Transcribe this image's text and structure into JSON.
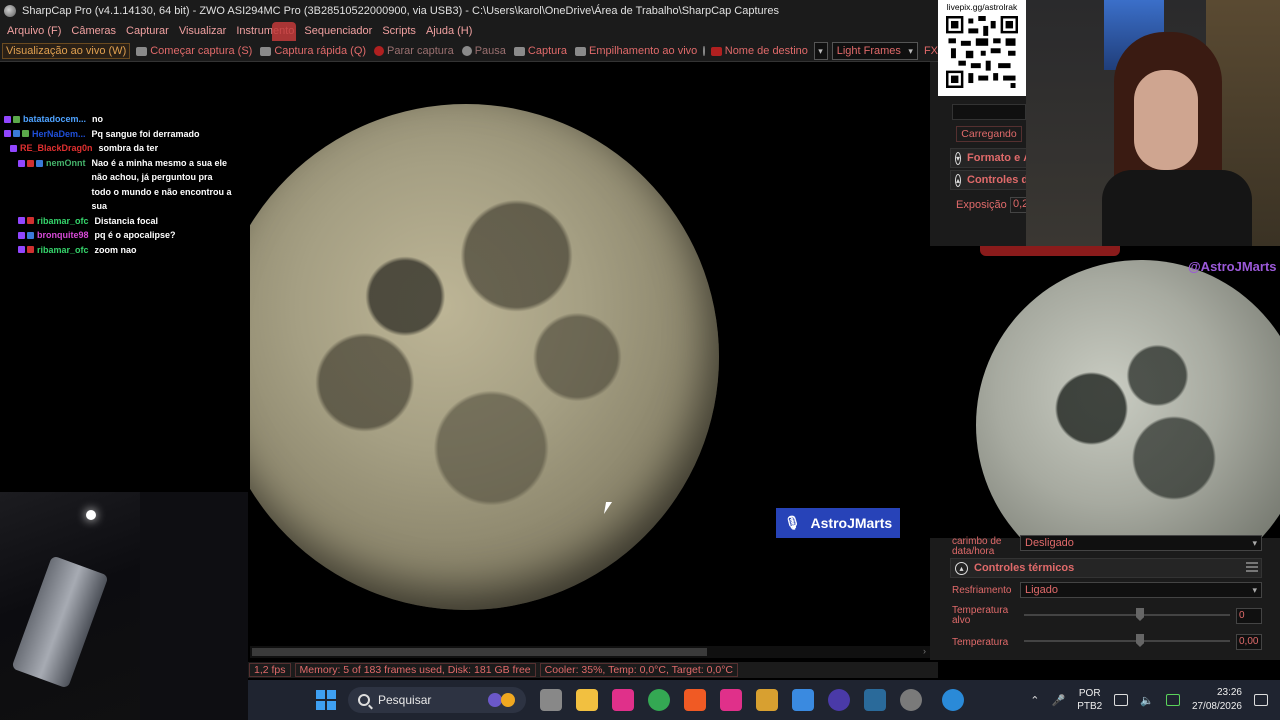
{
  "window": {
    "title": "SharpCap Pro (v4.1.14130, 64 bit) - ZWO ASI294MC Pro (3B28510522000900, via USB3) - C:\\Users\\karol\\OneDrive\\Área de Trabalho\\SharpCap Captures"
  },
  "menu": [
    "Arquivo (F)",
    "Câmeras",
    "Capturar",
    "Visualizar",
    "Instrumento",
    "Sequenciador",
    "Scripts",
    "Ajuda (H)"
  ],
  "toolbar": {
    "live_view": "Visualização ao vivo (W)",
    "start_capture": "Começar captura (S)",
    "quick_capture": "Captura rápida (Q)",
    "stop_capture": "Parar captura",
    "pause": "Pausa",
    "snapshot": "Captura",
    "live_stack": "Empilhamento ao vivo",
    "target_name": "Nome de destino",
    "target_value": "",
    "frame_type": "Light Frames",
    "fx": "FX"
  },
  "chat": [
    {
      "user": "batatadocem...",
      "color": "#4ea2ff",
      "message": "no"
    },
    {
      "user": "HerNaDem...",
      "color": "#1f4fd8",
      "message": "Pq sangue foi derramado"
    },
    {
      "user": "RE_BlackDrag0n",
      "color": "#e03030",
      "message": "sombra da ter"
    },
    {
      "user": "nemOnnt",
      "color": "#45b36b",
      "message": "Nao é a minha mesmo a sua ele não achou, já perguntou pra todo o mundo e não encontrou a sua"
    },
    {
      "user": "ribamar_ofc",
      "color": "#35d46b",
      "message": "Distancia focal"
    },
    {
      "user": "bronquite98",
      "color": "#d64ad6",
      "message": "pq é o apocalipse?"
    },
    {
      "user": "ribamar_ofc",
      "color": "#35d46b",
      "message": "zoom nao"
    }
  ],
  "qr": {
    "label": "livepix.gg/astrolrak"
  },
  "panel": {
    "loading": "Carregando",
    "section_format": "Formato e Á",
    "section_controls": "Controles da",
    "exposure_label": "Exposição",
    "exposure_value": "0,2",
    "timestamp_label": "carimbo de data/hora",
    "timestamp_value": "Desligado",
    "thermal_title": "Controles térmicos",
    "cooling_label": "Resfriamento",
    "cooling_value": "Ligado",
    "target_temp_label": "Temperatura alvo",
    "target_temp_value": "0",
    "temp_label": "Temperatura",
    "temp_value": "0,00"
  },
  "watermark": "@AstroJMarts",
  "streamer_tag": "AstroJMarts",
  "status": {
    "fps": "1,2 fps",
    "memory": "Memory: 5 of 183 frames used, Disk: 181 GB free",
    "cooler": "Cooler: 35%, Temp: 0,0°C, Target: 0,0°C"
  },
  "taskbar": {
    "search_placeholder": "Pesquisar",
    "lang_line1": "POR",
    "lang_line2": "PTB2",
    "time": "23:26",
    "date": "27/08/2026"
  },
  "colors": {
    "accent_red": "#e06a6a",
    "panel_bg": "#1b1b1b",
    "taskbar_bg": "#1f2430",
    "streamer_tag": "#2743b8"
  }
}
